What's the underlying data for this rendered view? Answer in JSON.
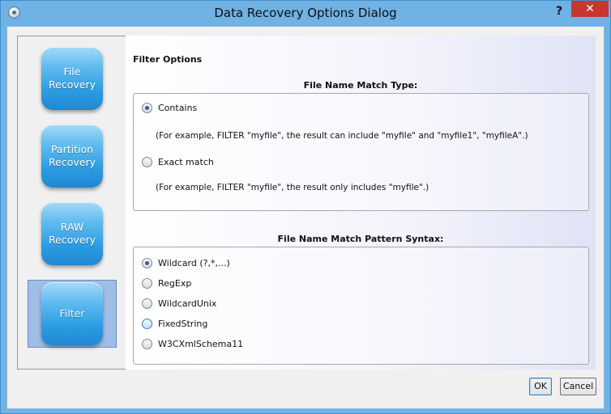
{
  "window": {
    "title": "Data Recovery Options Dialog",
    "help": "?",
    "close": "✕"
  },
  "sidebar": {
    "items": [
      {
        "label": "File\nRecovery"
      },
      {
        "label": "Partition\nRecovery"
      },
      {
        "label": "RAW\nRecovery"
      },
      {
        "label": "Filter"
      }
    ]
  },
  "content": {
    "section_title": "Filter Options",
    "match_type": {
      "label": "File Name Match Type:",
      "options": [
        {
          "label": "Contains",
          "note": "(For example, FILTER \"myfile\", the result can include \"myfile\" and \"myfile1\", \"myfileA\".)",
          "checked": true
        },
        {
          "label": "Exact match",
          "note": "(For example, FILTER \"myfile\", the result only includes \"myfile\".)",
          "checked": false
        }
      ]
    },
    "pattern_syntax": {
      "label": "File Name Match Pattern Syntax:",
      "options": [
        {
          "label": "Wildcard (?,*,...)",
          "checked": true
        },
        {
          "label": "RegExp",
          "checked": false
        },
        {
          "label": "WildcardUnix",
          "checked": false
        },
        {
          "label": "FixedString",
          "checked": false
        },
        {
          "label": "W3CXmlSchema11",
          "checked": false
        }
      ]
    }
  },
  "footer": {
    "ok": "OK",
    "cancel": "Cancel"
  }
}
